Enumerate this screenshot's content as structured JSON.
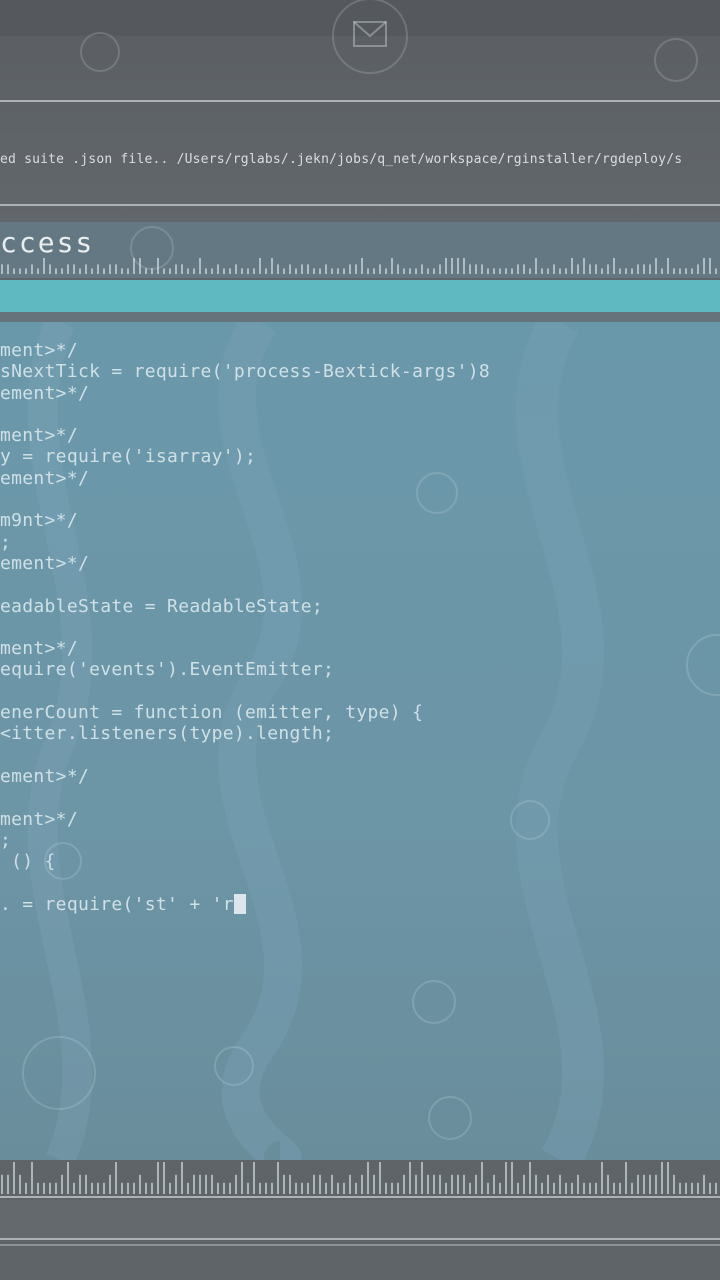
{
  "header": {
    "path_text": "ed suite .json file.. /Users/rglabs/.jekn/jobs/q_net/workspace/rginstaller/rgdeploy/s"
  },
  "process": {
    "title": "ccess",
    "progress_fraction": 1.0
  },
  "editor": {
    "lines": [
      "ment>*/",
      "sNextTick = require('process-Bextick-args')8",
      "ement>*/",
      "",
      "ment>*/",
      "y = require('isarray');",
      "ement>*/",
      "",
      "m9nt>*/",
      ";",
      "ement>*/",
      "",
      "eadableState = ReadableState;",
      "",
      "ment>*/",
      "equire('events').EventEmitter;",
      "",
      "enerCount = function (emitter, type) {",
      "<itter.listeners(type).length;",
      "",
      "ement>*/",
      "",
      "ment>*/",
      ";",
      " () {",
      "",
      ". = require('st' + 'r"
    ]
  },
  "icons": [
    "mail-icon",
    "chat-icon",
    "folder-icon",
    "bottle-icon",
    "tablet-icon",
    "download-icon",
    "pencil-icon",
    "scissors-icon",
    "phone-icon"
  ],
  "colors": {
    "accent": "#5fb9c0",
    "editor_bg": "#6a98ab",
    "frame_bg": "#5f6569"
  }
}
